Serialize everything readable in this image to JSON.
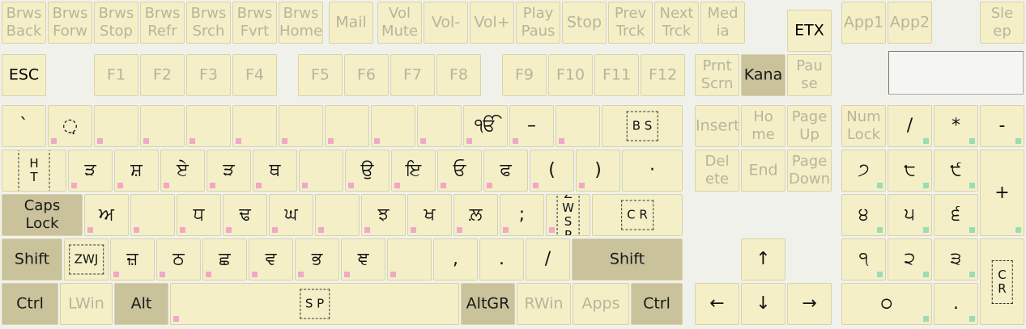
{
  "media_row": [
    {
      "id": "brws-back",
      "label": "Brws\nBack"
    },
    {
      "id": "brws-forw",
      "label": "Brws\nForw"
    },
    {
      "id": "brws-stop",
      "label": "Brws\nStop"
    },
    {
      "id": "brws-refr",
      "label": "Brws\nRefr"
    },
    {
      "id": "brws-srch",
      "label": "Brws\nSrch"
    },
    {
      "id": "brws-fvrt",
      "label": "Brws\nFvrt"
    },
    {
      "id": "brws-home",
      "label": "Brws\nHome"
    },
    {
      "id": "mail",
      "label": "Mail"
    },
    {
      "id": "vol-mute",
      "label": "Vol\nMute"
    },
    {
      "id": "vol-down",
      "label": "Vol-"
    },
    {
      "id": "vol-up",
      "label": "Vol+"
    },
    {
      "id": "play-paus",
      "label": "Play\nPaus"
    },
    {
      "id": "stop",
      "label": "Stop"
    },
    {
      "id": "prev-trck",
      "label": "Prev\nTrck"
    },
    {
      "id": "next-trck",
      "label": "Next\nTrck"
    },
    {
      "id": "media",
      "label": "Med\nia"
    },
    {
      "id": "etx",
      "label": "ETX"
    },
    {
      "id": "app1",
      "label": "App1"
    },
    {
      "id": "app2",
      "label": "App2"
    },
    {
      "id": "sleep",
      "label": "Sle\nep"
    }
  ],
  "function_row": [
    {
      "id": "esc",
      "label": "ESC"
    },
    {
      "id": "f1",
      "label": "F1"
    },
    {
      "id": "f2",
      "label": "F2"
    },
    {
      "id": "f3",
      "label": "F3"
    },
    {
      "id": "f4",
      "label": "F4"
    },
    {
      "id": "f5",
      "label": "F5"
    },
    {
      "id": "f6",
      "label": "F6"
    },
    {
      "id": "f7",
      "label": "F7"
    },
    {
      "id": "f8",
      "label": "F8"
    },
    {
      "id": "f9",
      "label": "F9"
    },
    {
      "id": "f10",
      "label": "F10"
    },
    {
      "id": "f11",
      "label": "F11"
    },
    {
      "id": "f12",
      "label": "F12"
    },
    {
      "id": "prnt-scrn",
      "label": "Prnt\nScrn"
    },
    {
      "id": "kana",
      "label": "Kana"
    },
    {
      "id": "pause",
      "label": "Pau\nse"
    }
  ],
  "number_row": [
    {
      "id": "backtick",
      "glyph": "`"
    },
    {
      "id": "1",
      "glyph": "◌̣"
    },
    {
      "id": "2",
      "glyph": ""
    },
    {
      "id": "3",
      "glyph": ""
    },
    {
      "id": "4",
      "glyph": ""
    },
    {
      "id": "5",
      "glyph": ""
    },
    {
      "id": "6",
      "glyph": ""
    },
    {
      "id": "7",
      "glyph": ""
    },
    {
      "id": "8",
      "glyph": ""
    },
    {
      "id": "9",
      "glyph": ""
    },
    {
      "id": "0",
      "glyph": "ੴ"
    },
    {
      "id": "minus",
      "glyph": "–"
    },
    {
      "id": "equals",
      "glyph": ""
    },
    {
      "id": "backspace",
      "boxed": "B S"
    }
  ],
  "top_row": [
    {
      "id": "tab",
      "boxed": "H T"
    },
    {
      "id": "q",
      "glyph": "ੜ"
    },
    {
      "id": "w",
      "glyph": "ਸ਼"
    },
    {
      "id": "e",
      "glyph": "ਏ"
    },
    {
      "id": "r",
      "glyph": "ੜ"
    },
    {
      "id": "t",
      "glyph": "ਥ"
    },
    {
      "id": "y",
      "glyph": ""
    },
    {
      "id": "u",
      "glyph": "ਉ"
    },
    {
      "id": "i",
      "glyph": "ਇ"
    },
    {
      "id": "o",
      "glyph": "ਓ"
    },
    {
      "id": "p",
      "glyph": "ਫ"
    },
    {
      "id": "lbracket",
      "glyph": "("
    },
    {
      "id": "rbracket",
      "glyph": ")"
    },
    {
      "id": "backslash",
      "glyph": "·"
    }
  ],
  "home_row": [
    {
      "id": "caps",
      "label": "Caps\nLock"
    },
    {
      "id": "a",
      "glyph": "ਅ"
    },
    {
      "id": "s",
      "glyph": ""
    },
    {
      "id": "d",
      "glyph": "ਧ"
    },
    {
      "id": "f",
      "glyph": "ਢ"
    },
    {
      "id": "g",
      "glyph": "ਘ"
    },
    {
      "id": "h",
      "glyph": ""
    },
    {
      "id": "j",
      "glyph": "ਝ"
    },
    {
      "id": "k",
      "glyph": "ਖ"
    },
    {
      "id": "l",
      "glyph": "ਲ਼"
    },
    {
      "id": "semicolon",
      "glyph": ";"
    },
    {
      "id": "quote",
      "boxed": "Z W\nS P"
    },
    {
      "id": "enter",
      "boxed": "C R"
    }
  ],
  "bottom_row": [
    {
      "id": "lshift",
      "label": "Shift"
    },
    {
      "id": "oem102",
      "boxed": "ZWJ"
    },
    {
      "id": "z",
      "glyph": "ਜ਼"
    },
    {
      "id": "x",
      "glyph": "ਠ"
    },
    {
      "id": "c",
      "glyph": "ਛ"
    },
    {
      "id": "v",
      "glyph": "ਵ"
    },
    {
      "id": "b",
      "glyph": "ਭ"
    },
    {
      "id": "n",
      "glyph": "ਞ"
    },
    {
      "id": "m",
      "glyph": ""
    },
    {
      "id": "comma",
      "glyph": ","
    },
    {
      "id": "period",
      "glyph": "."
    },
    {
      "id": "slash",
      "glyph": "/"
    },
    {
      "id": "rshift",
      "label": "Shift"
    }
  ],
  "space_row": [
    {
      "id": "lctrl",
      "label": "Ctrl"
    },
    {
      "id": "lwin",
      "label": "LWin"
    },
    {
      "id": "alt",
      "label": "Alt"
    },
    {
      "id": "space",
      "boxed": "S P"
    },
    {
      "id": "altgr",
      "label": "AltGR"
    },
    {
      "id": "rwin",
      "label": "RWin"
    },
    {
      "id": "apps",
      "label": "Apps"
    },
    {
      "id": "rctrl",
      "label": "Ctrl"
    }
  ],
  "nav_cluster": [
    {
      "id": "insert",
      "label": "Insert"
    },
    {
      "id": "home",
      "label": "Ho\nme"
    },
    {
      "id": "page-up",
      "label": "Page\nUp"
    },
    {
      "id": "delete",
      "label": "Del\nete"
    },
    {
      "id": "end",
      "label": "End"
    },
    {
      "id": "page-down",
      "label": "Page\nDown"
    },
    {
      "id": "arrow-up",
      "glyph": "↑"
    },
    {
      "id": "arrow-left",
      "glyph": "←"
    },
    {
      "id": "arrow-down",
      "glyph": "↓"
    },
    {
      "id": "arrow-right",
      "glyph": "→"
    }
  ],
  "numpad": [
    {
      "id": "num-lock",
      "label": "Num\nLock"
    },
    {
      "id": "num-divide",
      "glyph": "/"
    },
    {
      "id": "num-multiply",
      "glyph": "*"
    },
    {
      "id": "num-minus",
      "glyph": "-"
    },
    {
      "id": "num-7",
      "glyph": "੭"
    },
    {
      "id": "num-8",
      "glyph": "੮"
    },
    {
      "id": "num-9",
      "glyph": "੯"
    },
    {
      "id": "num-plus",
      "glyph": "+"
    },
    {
      "id": "num-4",
      "glyph": "੪"
    },
    {
      "id": "num-5",
      "glyph": "੫"
    },
    {
      "id": "num-6",
      "glyph": "੬"
    },
    {
      "id": "num-1",
      "glyph": "੧"
    },
    {
      "id": "num-2",
      "glyph": "੨"
    },
    {
      "id": "num-3",
      "glyph": "੩"
    },
    {
      "id": "num-enter",
      "boxed": "C R"
    },
    {
      "id": "num-0",
      "glyph": "੦"
    },
    {
      "id": "num-decimal",
      "glyph": "."
    }
  ],
  "colors": {
    "key": "#f4efc6",
    "modifier": "#c9c29a",
    "dim_text": "#b8b59c",
    "marker_pink": "#f0a8c8",
    "marker_green": "#9adcb4"
  }
}
